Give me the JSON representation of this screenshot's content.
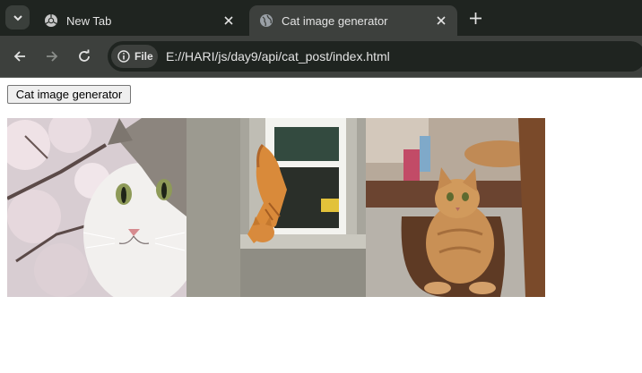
{
  "browser": {
    "tabs": [
      {
        "title": "New Tab",
        "icon": "chrome-icon",
        "active": false
      },
      {
        "title": "Cat image generator",
        "icon": "globe-icon",
        "active": true
      }
    ],
    "chip_label": "File",
    "url": "E://HARI/js/day9/api/cat_post/index.html"
  },
  "page": {
    "button_label": "Cat image generator",
    "images": [
      {
        "icon": "cat-blossom-photo"
      },
      {
        "icon": "cat-window-photo"
      },
      {
        "icon": "cat-chair-photo"
      }
    ]
  },
  "colors": {
    "tabstrip": "#1f2420",
    "toolbar": "#3d403d",
    "text": "#e3e3e3"
  }
}
